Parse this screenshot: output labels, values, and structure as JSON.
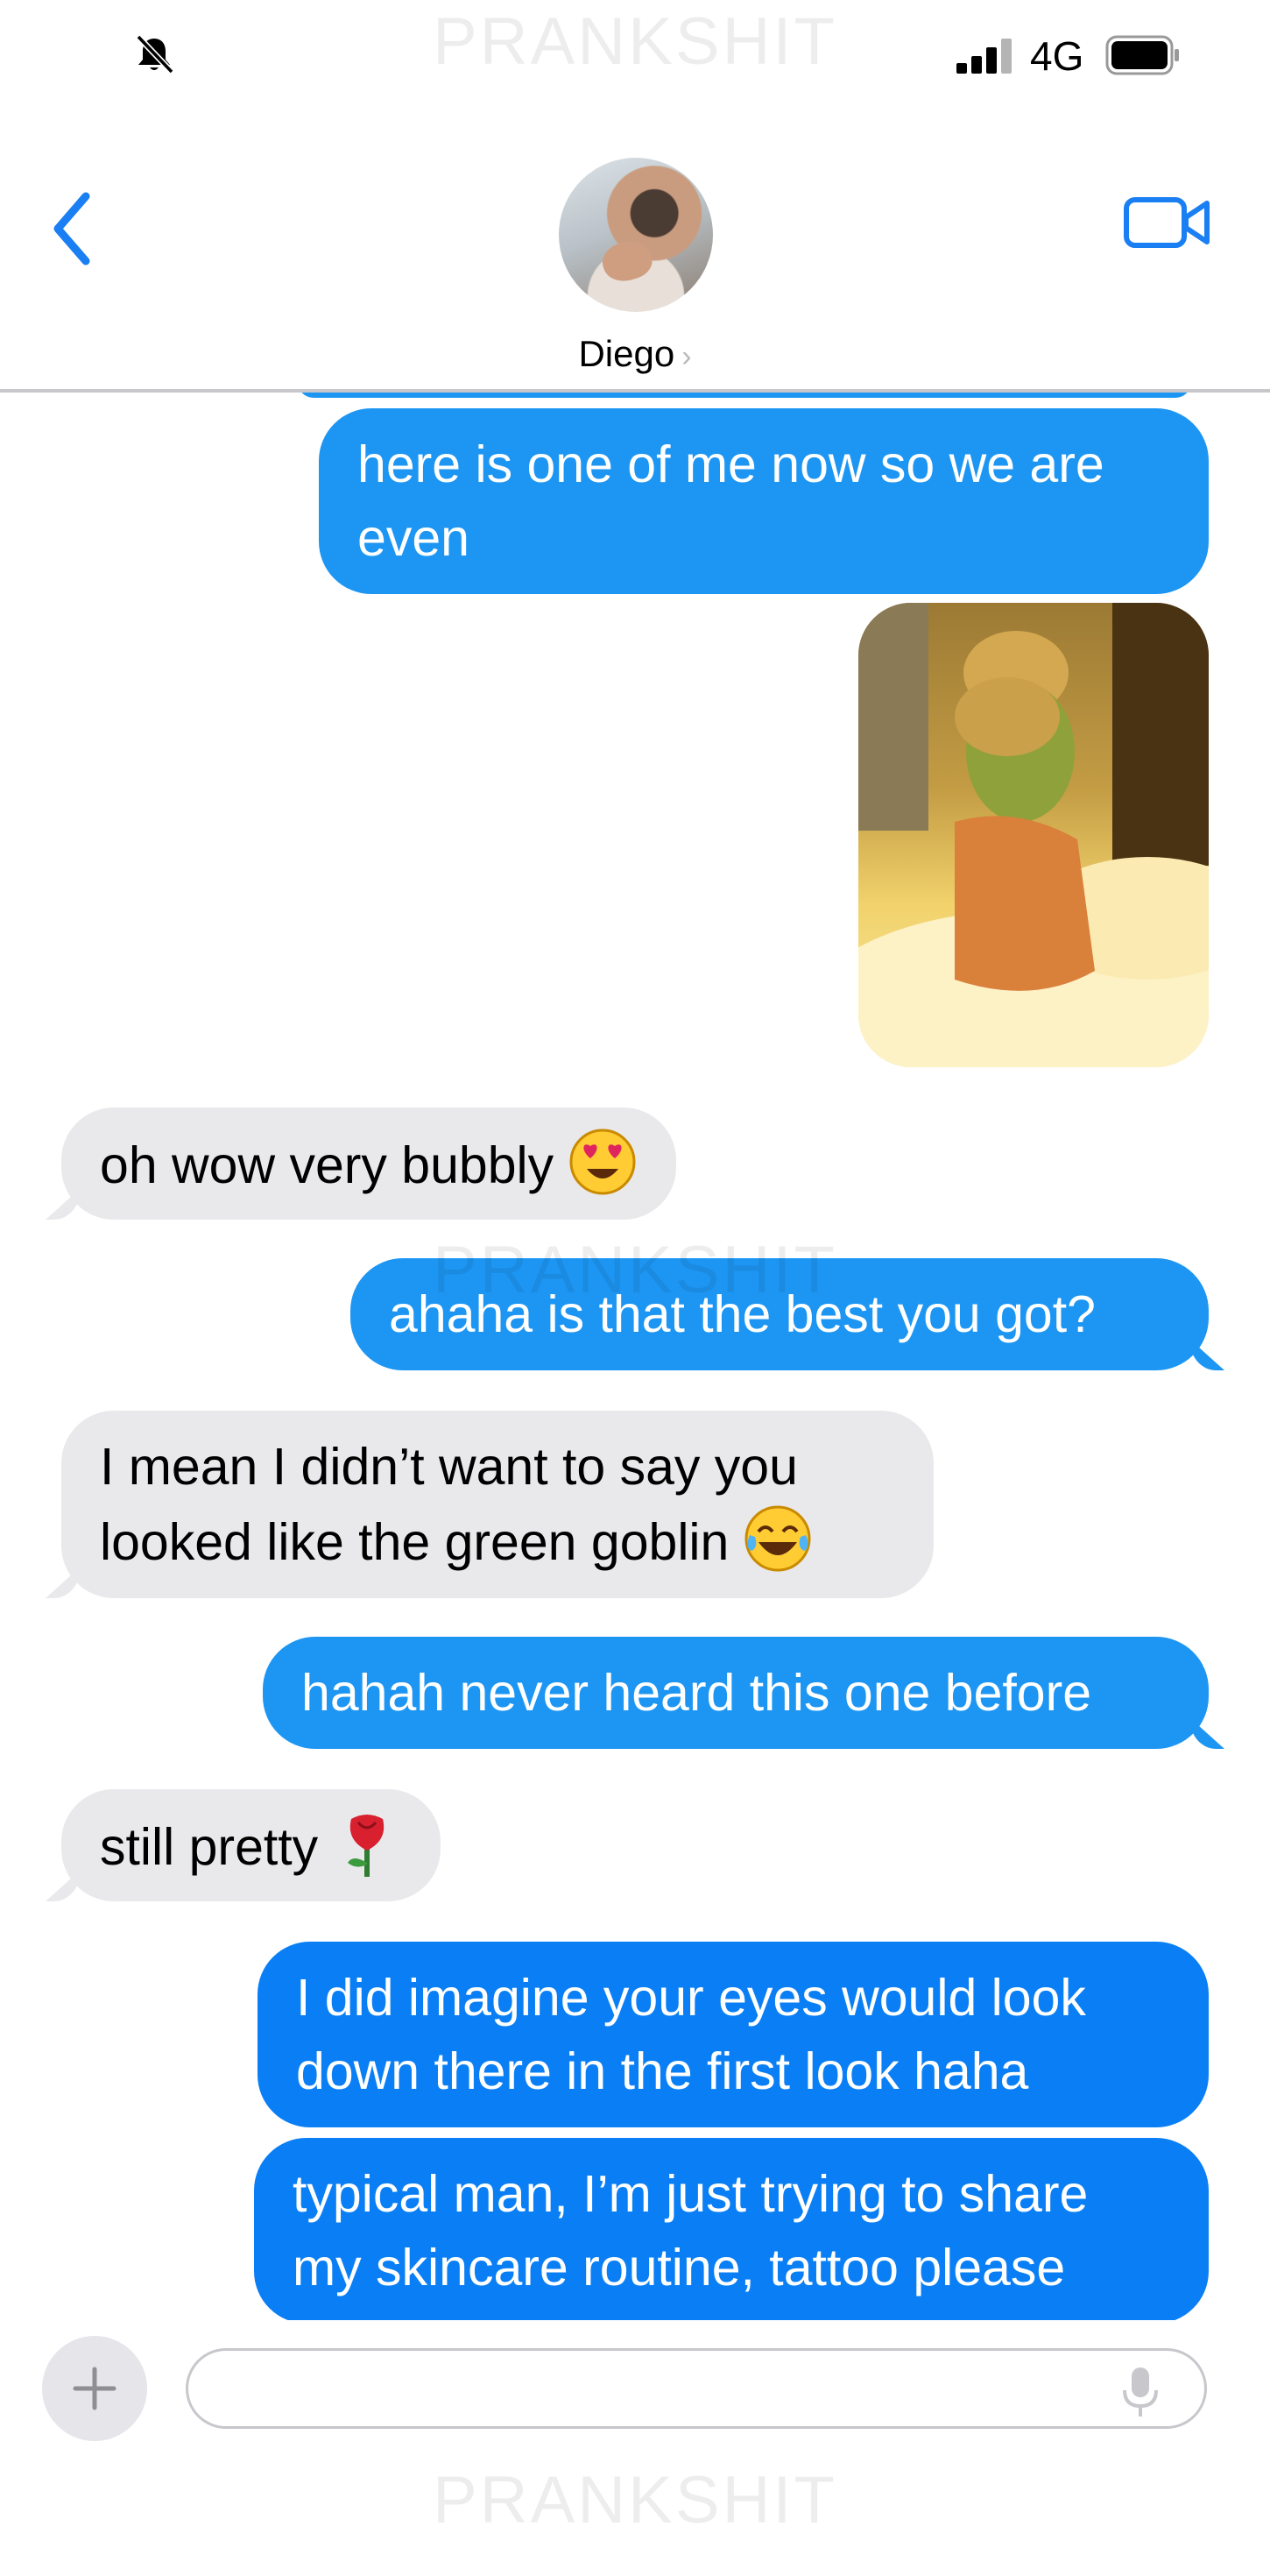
{
  "status_bar": {
    "network": "4G",
    "icons": [
      "bell-slash-icon",
      "signal-icon",
      "battery-icon"
    ]
  },
  "header": {
    "contact_name": "Diego",
    "icons": [
      "chevron-left-icon",
      "video-camera-icon"
    ]
  },
  "watermark": "PRANKSHIT",
  "messages": [
    {
      "from": "me",
      "text_lines": [
        "here is one of me now so we are",
        "even"
      ]
    },
    {
      "from": "me",
      "type": "photo"
    },
    {
      "from": "them",
      "text": "oh wow very bubbly",
      "emoji": "heart-eyes-emoji"
    },
    {
      "from": "me",
      "text": "ahaha is that the best you got?"
    },
    {
      "from": "them",
      "text_lines": [
        "I mean I didn’t want to say you",
        "looked like the green goblin"
      ],
      "emoji": "tears-of-joy-emoji"
    },
    {
      "from": "me",
      "text": "hahah never heard this one before"
    },
    {
      "from": "them",
      "text": "still pretty",
      "emoji": "rose-emoji"
    },
    {
      "from": "me",
      "text_lines": [
        "I did imagine your eyes would look",
        "down there in the first look haha"
      ]
    },
    {
      "from": "me",
      "text_lines": [
        "typical man, I’m just trying to share",
        "my skincare routine, tattoo please"
      ]
    }
  ],
  "input_bar": {
    "placeholder": "",
    "icons": [
      "plus-icon",
      "microphone-icon"
    ]
  },
  "colors": {
    "sent": "#1d96f3",
    "sent_dark": "#0a7ff5",
    "received": "#e9e9eb",
    "accent": "#1a7ff2"
  }
}
